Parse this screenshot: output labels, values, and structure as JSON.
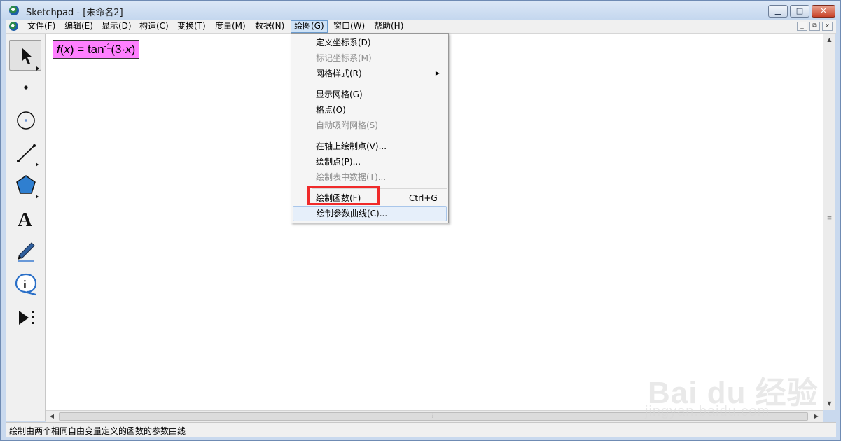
{
  "window": {
    "title": "Sketchpad  - [未命名2]",
    "controls": {
      "minimize": "▁",
      "maximize": "□",
      "close": "✕"
    }
  },
  "menubar": {
    "items": [
      "文件(F)",
      "编辑(E)",
      "显示(D)",
      "构造(C)",
      "变换(T)",
      "度量(M)",
      "数据(N)",
      "绘图(G)",
      "窗口(W)",
      "帮助(H)"
    ],
    "active_item": "绘图(G)",
    "mdi_controls": [
      "_",
      "⧉",
      "x"
    ]
  },
  "toolbox": {
    "tools": [
      "selection-arrow-tool",
      "point-tool",
      "compass-tool",
      "straightedge-tool",
      "polygon-tool",
      "text-tool",
      "marker-tool",
      "information-tool",
      "custom-tool"
    ],
    "text_tool_glyph": "A",
    "info_tool_glyph": "i"
  },
  "canvas": {
    "function_label": {
      "f": "f",
      "x1": "x",
      "eq": ") = tan",
      "sup": "-1",
      "arg": "(3·",
      "x2": "x",
      "close": ")"
    },
    "label_color": "#ff7fff"
  },
  "dropdown": {
    "items": [
      {
        "label": "定义坐标系(D)",
        "enabled": true
      },
      {
        "label": "标记坐标系(M)",
        "enabled": false
      },
      {
        "label": "网格样式(R)",
        "enabled": true,
        "submenu": true
      },
      {
        "label": "显示网格(G)",
        "enabled": true
      },
      {
        "label": "格点(O)",
        "enabled": true
      },
      {
        "label": "自动吸附网格(S)",
        "enabled": false
      },
      {
        "label": "在轴上绘制点(V)...",
        "enabled": true
      },
      {
        "label": "绘制点(P)...",
        "enabled": true
      },
      {
        "label": "绘制表中数据(T)...",
        "enabled": false
      },
      {
        "label": "绘制函数(F)",
        "enabled": true,
        "shortcut": "Ctrl+G",
        "highlighted_red": true
      },
      {
        "label": "绘制参数曲线(C)...",
        "enabled": true,
        "hover": true
      }
    ],
    "highlight_color": "#f02a2a"
  },
  "statusbar": {
    "text": "绘制由两个相同自由变量定义的函数的参数曲线"
  },
  "watermark": {
    "logo": "Bai du 经验",
    "sub": "jingyan.baidu.com"
  }
}
